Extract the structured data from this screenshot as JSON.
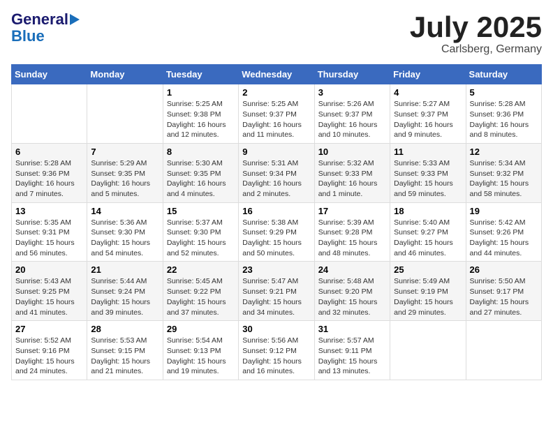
{
  "logo": {
    "line1": "General",
    "line2": "Blue"
  },
  "title": "July 2025",
  "subtitle": "Carlsberg, Germany",
  "days_header": [
    "Sunday",
    "Monday",
    "Tuesday",
    "Wednesday",
    "Thursday",
    "Friday",
    "Saturday"
  ],
  "weeks": [
    [
      {
        "day": "",
        "info": ""
      },
      {
        "day": "",
        "info": ""
      },
      {
        "day": "1",
        "info": "Sunrise: 5:25 AM\nSunset: 9:38 PM\nDaylight: 16 hours and 12 minutes."
      },
      {
        "day": "2",
        "info": "Sunrise: 5:25 AM\nSunset: 9:37 PM\nDaylight: 16 hours and 11 minutes."
      },
      {
        "day": "3",
        "info": "Sunrise: 5:26 AM\nSunset: 9:37 PM\nDaylight: 16 hours and 10 minutes."
      },
      {
        "day": "4",
        "info": "Sunrise: 5:27 AM\nSunset: 9:37 PM\nDaylight: 16 hours and 9 minutes."
      },
      {
        "day": "5",
        "info": "Sunrise: 5:28 AM\nSunset: 9:36 PM\nDaylight: 16 hours and 8 minutes."
      }
    ],
    [
      {
        "day": "6",
        "info": "Sunrise: 5:28 AM\nSunset: 9:36 PM\nDaylight: 16 hours and 7 minutes."
      },
      {
        "day": "7",
        "info": "Sunrise: 5:29 AM\nSunset: 9:35 PM\nDaylight: 16 hours and 5 minutes."
      },
      {
        "day": "8",
        "info": "Sunrise: 5:30 AM\nSunset: 9:35 PM\nDaylight: 16 hours and 4 minutes."
      },
      {
        "day": "9",
        "info": "Sunrise: 5:31 AM\nSunset: 9:34 PM\nDaylight: 16 hours and 2 minutes."
      },
      {
        "day": "10",
        "info": "Sunrise: 5:32 AM\nSunset: 9:33 PM\nDaylight: 16 hours and 1 minute."
      },
      {
        "day": "11",
        "info": "Sunrise: 5:33 AM\nSunset: 9:33 PM\nDaylight: 15 hours and 59 minutes."
      },
      {
        "day": "12",
        "info": "Sunrise: 5:34 AM\nSunset: 9:32 PM\nDaylight: 15 hours and 58 minutes."
      }
    ],
    [
      {
        "day": "13",
        "info": "Sunrise: 5:35 AM\nSunset: 9:31 PM\nDaylight: 15 hours and 56 minutes."
      },
      {
        "day": "14",
        "info": "Sunrise: 5:36 AM\nSunset: 9:30 PM\nDaylight: 15 hours and 54 minutes."
      },
      {
        "day": "15",
        "info": "Sunrise: 5:37 AM\nSunset: 9:30 PM\nDaylight: 15 hours and 52 minutes."
      },
      {
        "day": "16",
        "info": "Sunrise: 5:38 AM\nSunset: 9:29 PM\nDaylight: 15 hours and 50 minutes."
      },
      {
        "day": "17",
        "info": "Sunrise: 5:39 AM\nSunset: 9:28 PM\nDaylight: 15 hours and 48 minutes."
      },
      {
        "day": "18",
        "info": "Sunrise: 5:40 AM\nSunset: 9:27 PM\nDaylight: 15 hours and 46 minutes."
      },
      {
        "day": "19",
        "info": "Sunrise: 5:42 AM\nSunset: 9:26 PM\nDaylight: 15 hours and 44 minutes."
      }
    ],
    [
      {
        "day": "20",
        "info": "Sunrise: 5:43 AM\nSunset: 9:25 PM\nDaylight: 15 hours and 41 minutes."
      },
      {
        "day": "21",
        "info": "Sunrise: 5:44 AM\nSunset: 9:24 PM\nDaylight: 15 hours and 39 minutes."
      },
      {
        "day": "22",
        "info": "Sunrise: 5:45 AM\nSunset: 9:22 PM\nDaylight: 15 hours and 37 minutes."
      },
      {
        "day": "23",
        "info": "Sunrise: 5:47 AM\nSunset: 9:21 PM\nDaylight: 15 hours and 34 minutes."
      },
      {
        "day": "24",
        "info": "Sunrise: 5:48 AM\nSunset: 9:20 PM\nDaylight: 15 hours and 32 minutes."
      },
      {
        "day": "25",
        "info": "Sunrise: 5:49 AM\nSunset: 9:19 PM\nDaylight: 15 hours and 29 minutes."
      },
      {
        "day": "26",
        "info": "Sunrise: 5:50 AM\nSunset: 9:17 PM\nDaylight: 15 hours and 27 minutes."
      }
    ],
    [
      {
        "day": "27",
        "info": "Sunrise: 5:52 AM\nSunset: 9:16 PM\nDaylight: 15 hours and 24 minutes."
      },
      {
        "day": "28",
        "info": "Sunrise: 5:53 AM\nSunset: 9:15 PM\nDaylight: 15 hours and 21 minutes."
      },
      {
        "day": "29",
        "info": "Sunrise: 5:54 AM\nSunset: 9:13 PM\nDaylight: 15 hours and 19 minutes."
      },
      {
        "day": "30",
        "info": "Sunrise: 5:56 AM\nSunset: 9:12 PM\nDaylight: 15 hours and 16 minutes."
      },
      {
        "day": "31",
        "info": "Sunrise: 5:57 AM\nSunset: 9:11 PM\nDaylight: 15 hours and 13 minutes."
      },
      {
        "day": "",
        "info": ""
      },
      {
        "day": "",
        "info": ""
      }
    ]
  ]
}
